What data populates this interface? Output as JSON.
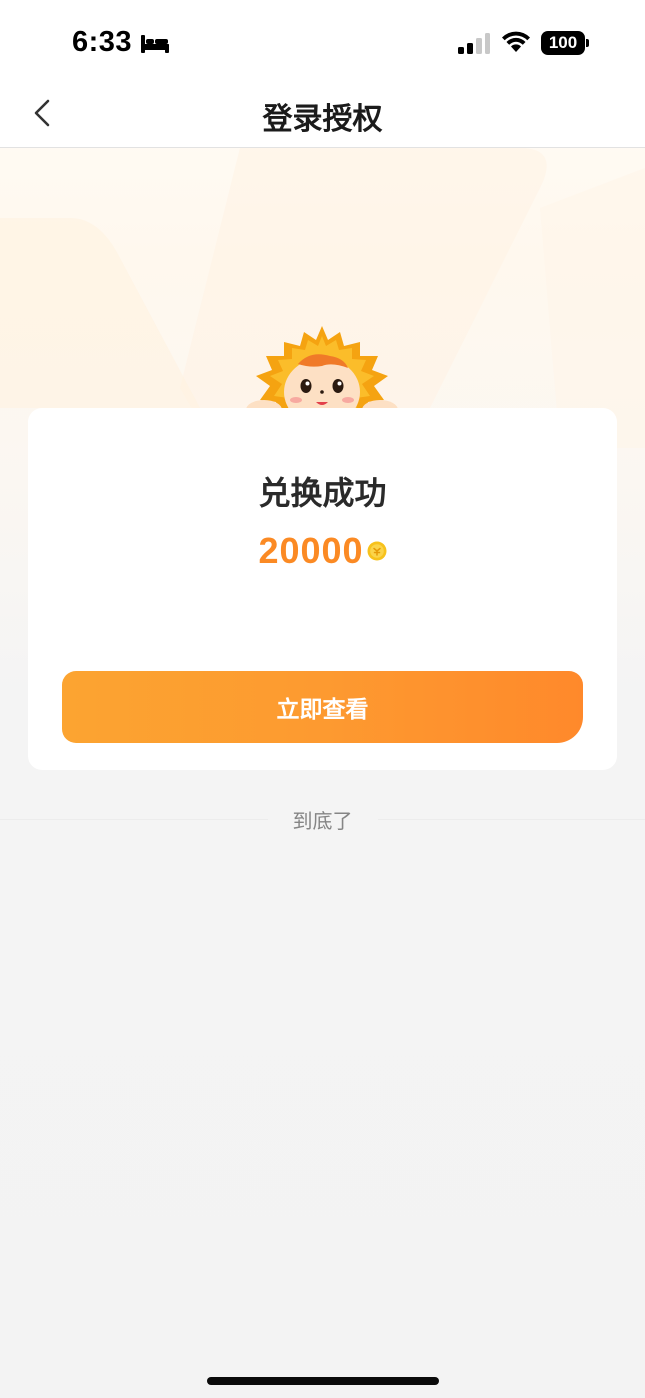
{
  "status_bar": {
    "time": "6:33",
    "battery": "100",
    "icons": [
      "bed-icon",
      "signal-icon",
      "wifi-icon",
      "battery-icon"
    ]
  },
  "nav": {
    "title": "登录授权",
    "back_icon": "chevron-left-icon"
  },
  "card": {
    "title": "兑换成功",
    "amount": "20000",
    "coin_icon": "coin-icon",
    "button_label": "立即查看"
  },
  "footer": {
    "end_text": "到底了"
  },
  "colors": {
    "accent": "#fb8a24",
    "button_start": "#fca431",
    "button_end": "#ff892b",
    "coin": "#f7c21c"
  }
}
